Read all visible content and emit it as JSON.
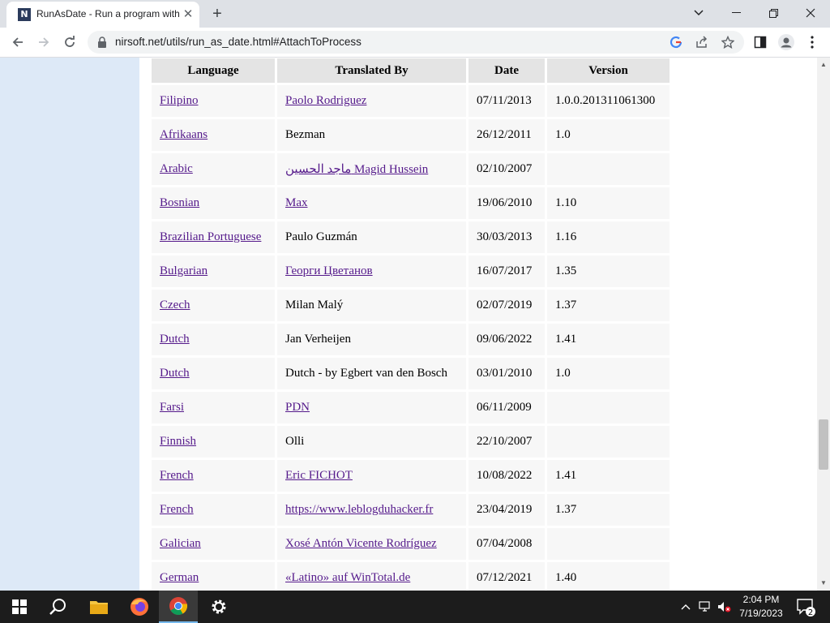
{
  "browser": {
    "tab_title": "RunAsDate - Run a program with",
    "favicon_letter": "N",
    "url": "nirsoft.net/utils/run_as_date.html#AttachToProcess"
  },
  "table": {
    "headers": [
      "Language",
      "Translated By",
      "Date",
      "Version"
    ],
    "rows": [
      {
        "language": "Filipino",
        "translator": "Paolo Rodriguez",
        "date": "07/11/2013",
        "version": "1.0.0.201311061300"
      },
      {
        "language": "Afrikaans",
        "translator": "Bezman",
        "date": "26/12/2011",
        "version": "1.0"
      },
      {
        "language": "Arabic",
        "translator": "ماجد الحسين Magid Hussein",
        "date": "02/10/2007",
        "version": ""
      },
      {
        "language": "Bosnian",
        "translator": "Max",
        "date": "19/06/2010",
        "version": "1.10"
      },
      {
        "language": "Brazilian Portuguese",
        "translator": "Paulo Guzmán",
        "date": "30/03/2013",
        "version": "1.16"
      },
      {
        "language": "Bulgarian",
        "translator": "Георги Цветанов",
        "date": "16/07/2017",
        "version": "1.35"
      },
      {
        "language": "Czech",
        "translator": "Milan Malý",
        "date": "02/07/2019",
        "version": "1.37"
      },
      {
        "language": "Dutch",
        "translator": "Jan Verheijen",
        "date": "09/06/2022",
        "version": "1.41"
      },
      {
        "language": "Dutch",
        "translator": "Dutch - by Egbert van den Bosch",
        "date": "03/01/2010",
        "version": "1.0"
      },
      {
        "language": "Farsi",
        "translator": "PDN",
        "date": "06/11/2009",
        "version": ""
      },
      {
        "language": "Finnish",
        "translator": "Olli",
        "date": "22/10/2007",
        "version": ""
      },
      {
        "language": "French",
        "translator": "Eric FICHOT",
        "date": "10/08/2022",
        "version": "1.41"
      },
      {
        "language": "French",
        "translator": "https://www.leblogduhacker.fr",
        "date": "23/04/2019",
        "version": "1.37"
      },
      {
        "language": "Galician",
        "translator": "Xosé Antón Vicente Rodríguez",
        "date": "07/04/2008",
        "version": ""
      },
      {
        "language": "German",
        "translator": "«Latino» auf WinTotal.de",
        "date": "07/12/2021",
        "version": "1.40"
      }
    ]
  },
  "taskbar": {
    "time": "2:04 PM",
    "date": "7/19/2023",
    "notification_count": "2"
  },
  "colors": {
    "link": "#551a8b",
    "left_panel": "#dde9f7",
    "header_cell": "#e4e4e4",
    "taskbar": "#1c1c1c"
  }
}
